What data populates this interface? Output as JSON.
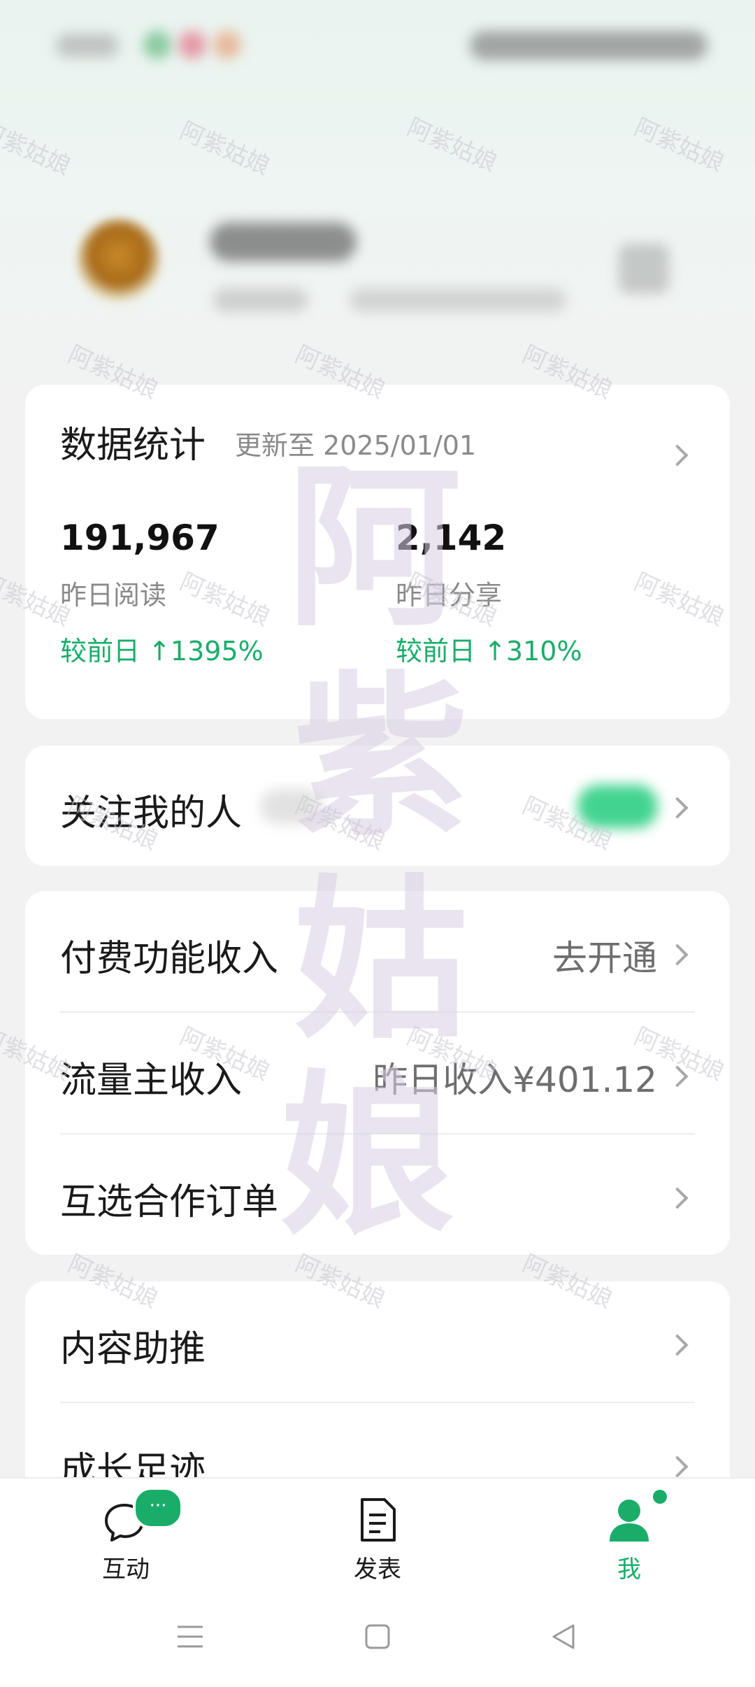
{
  "stats": {
    "title": "数据统计",
    "updated": "更新至 2025/01/01",
    "read_value": "191,967",
    "read_label": "昨日阅读",
    "read_change": "较前日 ↑1395%",
    "share_value": "2,142",
    "share_label": "昨日分享",
    "share_change": "较前日 ↑310%"
  },
  "followers": {
    "label": "关注我的人"
  },
  "income": {
    "paid_label": "付费功能收入",
    "paid_value": "去开通",
    "traffic_label": "流量主收入",
    "traffic_value": "昨日收入¥401.12",
    "coop_label": "互选合作订单"
  },
  "tools": {
    "boost_label": "内容助推",
    "growth_label": "成长足迹"
  },
  "nav": {
    "interact": "互动",
    "interact_badge": "···",
    "publish": "发表",
    "me": "我"
  },
  "watermark": {
    "small": "阿紫姑娘",
    "big": [
      "阿",
      "紫",
      "姑",
      "娘"
    ]
  },
  "colors": {
    "accent_green": "#1aad6a",
    "nav_green": "#1aad6a",
    "text_primary": "#1a1a1a",
    "text_secondary": "#8a8a8a"
  },
  "icons": {
    "chat": "chat-bubble-icon",
    "publish": "document-icon",
    "me": "person-icon",
    "chevron": "chevron-right-icon",
    "sys_menu": "menu-icon",
    "sys_home": "home-square-icon",
    "sys_back": "back-triangle-icon"
  }
}
